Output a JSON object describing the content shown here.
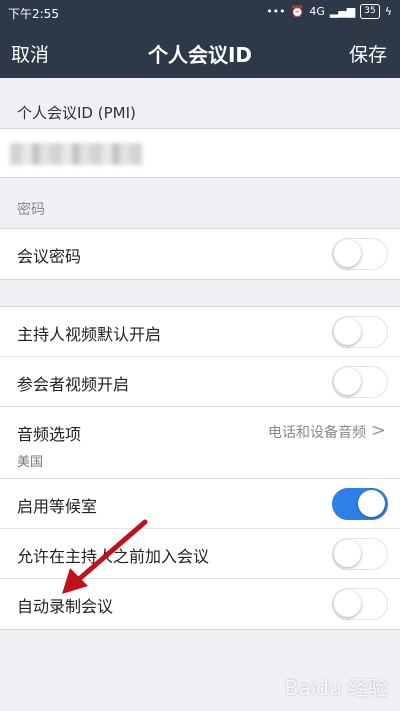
{
  "status_bar": {
    "time": "下午2:55",
    "network": "4G",
    "battery": "35"
  },
  "nav": {
    "cancel_label": "取消",
    "title": "个人会议ID",
    "save_label": "保存"
  },
  "pmi": {
    "label": "个人会议ID (PMI)"
  },
  "password_section": {
    "header": "密码",
    "meeting_password_label": "会议密码",
    "meeting_password_on": false
  },
  "settings": {
    "host_video_label": "主持人视频默认开启",
    "host_video_on": false,
    "participant_video_label": "参会者视频开启",
    "participant_video_on": false,
    "audio_label": "音频选项",
    "audio_value": "电话和设备音频",
    "audio_sub": "美国",
    "waiting_room_label": "启用等候室",
    "waiting_room_on": true,
    "join_before_host_label": "允许在主持人之前加入会议",
    "join_before_host_on": false,
    "auto_record_label": "自动录制会议",
    "auto_record_on": false
  },
  "watermark": "Baidu 经验",
  "colors": {
    "navbar": "#2d3849",
    "toggle_on": "#2f7fe8",
    "arrow": "#c0121b"
  }
}
